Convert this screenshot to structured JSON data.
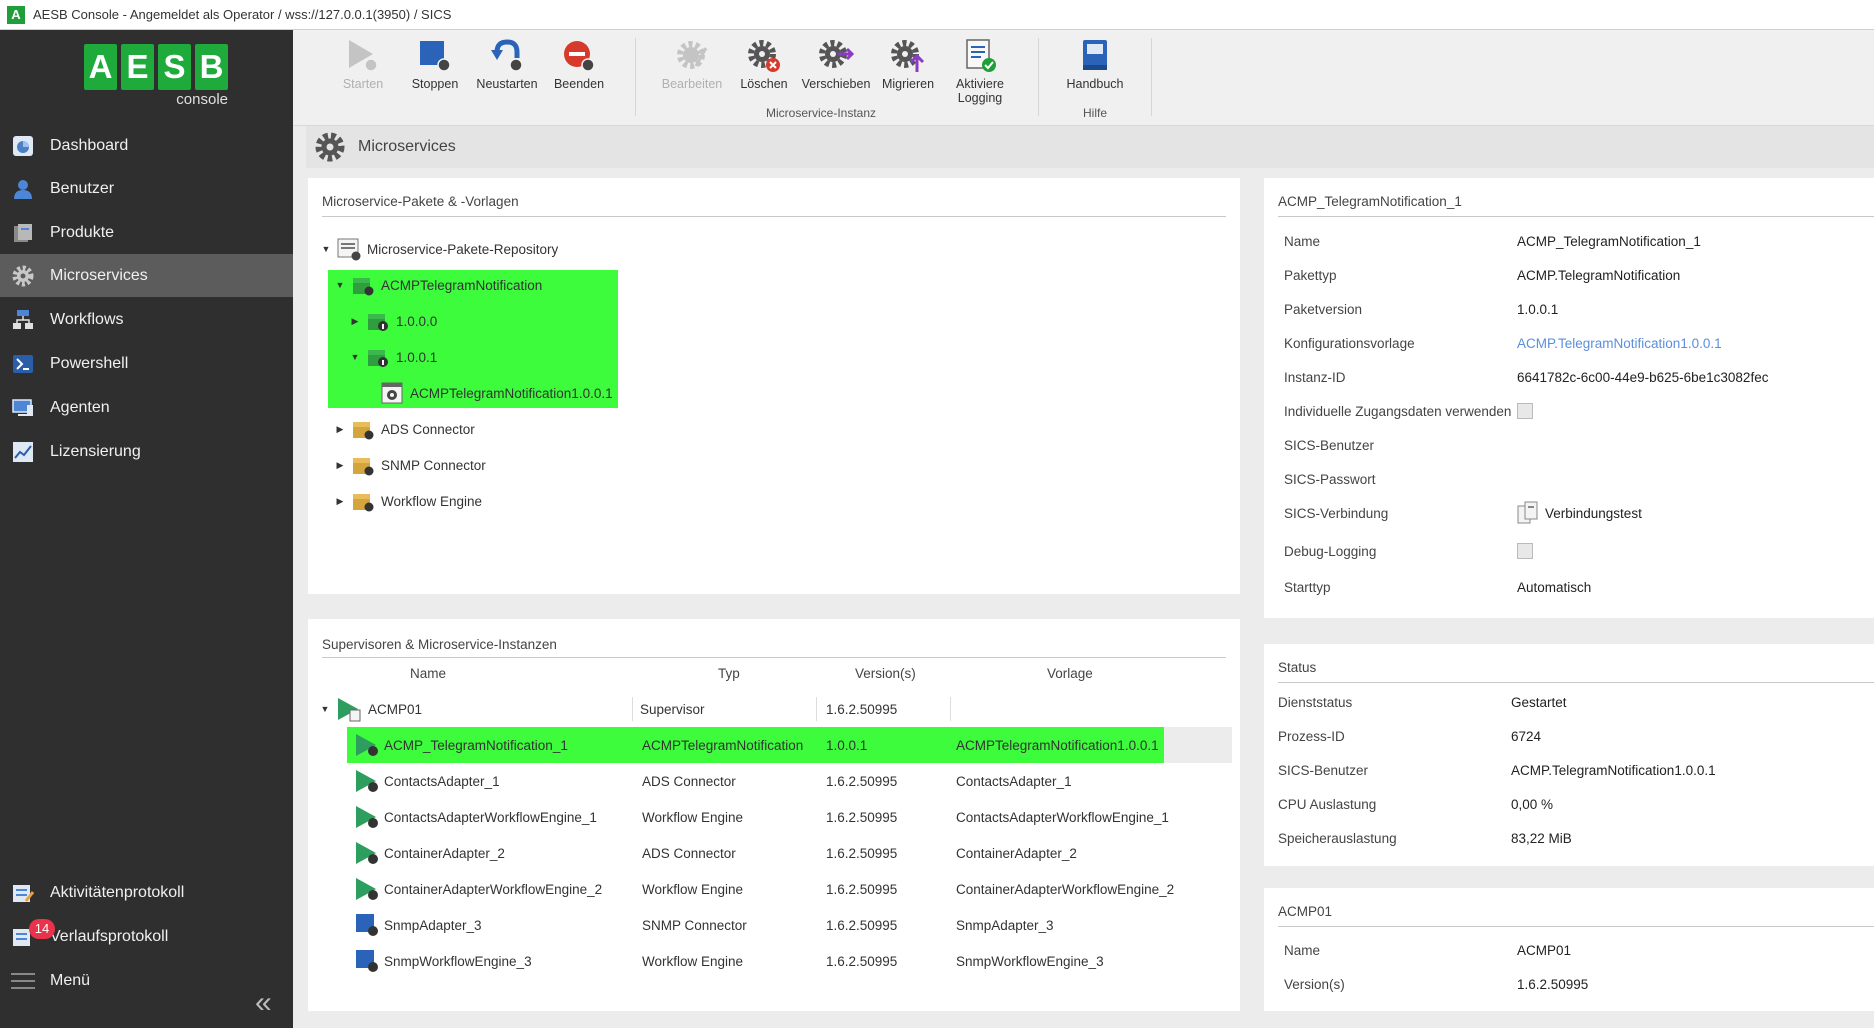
{
  "window": {
    "title": "AESB Console - Angemeldet als Operator / wss://127.0.0.1(3950) / SICS",
    "icon_letter": "A"
  },
  "sidebar": {
    "logo_letters": [
      "A",
      "E",
      "S",
      "B"
    ],
    "logo_sub": "console",
    "items": [
      {
        "label": "Dashboard",
        "icon": "dashboard-icon"
      },
      {
        "label": "Benutzer",
        "icon": "user-icon"
      },
      {
        "label": "Produkte",
        "icon": "products-icon"
      },
      {
        "label": "Microservices",
        "icon": "gear-icon",
        "active": true
      },
      {
        "label": "Workflows",
        "icon": "workflow-icon"
      },
      {
        "label": "Powershell",
        "icon": "powershell-icon"
      },
      {
        "label": "Agenten",
        "icon": "monitor-icon"
      },
      {
        "label": "Lizensierung",
        "icon": "chart-icon"
      }
    ],
    "bottom_items": [
      {
        "label": "Aktivitätenprotokoll",
        "icon": "activity-log-icon"
      },
      {
        "label": "Verlaufsprotokoll",
        "icon": "history-log-icon",
        "badge": "14"
      },
      {
        "label": "Menü",
        "icon": "hamburger-icon"
      }
    ],
    "collapse_glyph": "«"
  },
  "ribbon": {
    "buttons": {
      "start": "Starten",
      "stop": "Stoppen",
      "restart": "Neustarten",
      "quit": "Beenden",
      "edit": "Bearbeiten",
      "delete": "Löschen",
      "move": "Verschieben",
      "migrate": "Migrieren",
      "logging_1": "Aktiviere",
      "logging_2": "Logging",
      "manual": "Handbuch"
    },
    "groups": {
      "instance": "Microservice-Instanz",
      "help": "Hilfe"
    }
  },
  "page": {
    "title": "Microservices"
  },
  "packages": {
    "title": "Microservice-Pakete & -Vorlagen",
    "root": "Microservice-Pakete-Repository",
    "acmp": "ACMPTelegramNotification",
    "v100": "1.0.0.0",
    "v101": "1.0.0.1",
    "template": "ACMPTelegramNotification1.0.0.1",
    "ads": "ADS Connector",
    "snmp": "SNMP Connector",
    "workflow": "Workflow Engine"
  },
  "instances": {
    "title": "Supervisoren & Microservice-Instanzen",
    "columns": {
      "name": "Name",
      "type": "Typ",
      "version": "Version(s)",
      "template": "Vorlage"
    },
    "supervisor": {
      "name": "ACMP01",
      "type": "Supervisor",
      "version": "1.6.2.50995",
      "template": ""
    },
    "rows": [
      {
        "name": "ACMP_TelegramNotification_1",
        "type": "ACMPTelegramNotification",
        "version": "1.0.0.1",
        "template": "ACMPTelegramNotification1.0.0.1",
        "status": "running"
      },
      {
        "name": "ContactsAdapter_1",
        "type": "ADS Connector",
        "version": "1.6.2.50995",
        "template": "ContactsAdapter_1",
        "status": "running"
      },
      {
        "name": "ContactsAdapterWorkflowEngine_1",
        "type": "Workflow Engine",
        "version": "1.6.2.50995",
        "template": "ContactsAdapterWorkflowEngine_1",
        "status": "running"
      },
      {
        "name": "ContainerAdapter_2",
        "type": "ADS Connector",
        "version": "1.6.2.50995",
        "template": "ContainerAdapter_2",
        "status": "running"
      },
      {
        "name": "ContainerAdapterWorkflowEngine_2",
        "type": "Workflow Engine",
        "version": "1.6.2.50995",
        "template": "ContainerAdapterWorkflowEngine_2",
        "status": "running"
      },
      {
        "name": "SnmpAdapter_3",
        "type": "SNMP Connector",
        "version": "1.6.2.50995",
        "template": "SnmpAdapter_3",
        "status": "stopped"
      },
      {
        "name": "SnmpWorkflowEngine_3",
        "type": "Workflow Engine",
        "version": "1.6.2.50995",
        "template": "SnmpWorkflowEngine_3",
        "status": "stopped"
      }
    ]
  },
  "details": {
    "title": "ACMP_TelegramNotification_1",
    "name_label": "Name",
    "name": "ACMP_TelegramNotification_1",
    "type_label": "Pakettyp",
    "type": "ACMP.TelegramNotification",
    "version_label": "Paketversion",
    "version": "1.0.0.1",
    "config_label": "Konfigurationsvorlage",
    "config": "ACMP.TelegramNotification1.0.0.1",
    "instance_label": "Instanz-ID",
    "instance": "6641782c-6c00-44e9-b625-6be1c3082fec",
    "creds_label": "Individuelle Zugangsdaten verwenden",
    "sics_user_label": "SICS-Benutzer",
    "sics_pw_label": "SICS-Passwort",
    "sics_conn_label": "SICS-Verbindung",
    "conn_test": "Verbindungstest",
    "debug_label": "Debug-Logging",
    "start_label": "Starttyp",
    "start": "Automatisch"
  },
  "status": {
    "title": "Status",
    "service_label": "Dienststatus",
    "service": "Gestartet",
    "pid_label": "Prozess-ID",
    "pid": "6724",
    "user_label": "SICS-Benutzer",
    "user": "ACMP.TelegramNotification1.0.0.1",
    "cpu_label": "CPU Auslastung",
    "cpu": "0,00 %",
    "mem_label": "Speicherauslastung",
    "mem": "83,22 MiB"
  },
  "host": {
    "title": "ACMP01",
    "name_label": "Name",
    "name": "ACMP01",
    "version_label": "Version(s)",
    "version": "1.6.2.50995"
  }
}
